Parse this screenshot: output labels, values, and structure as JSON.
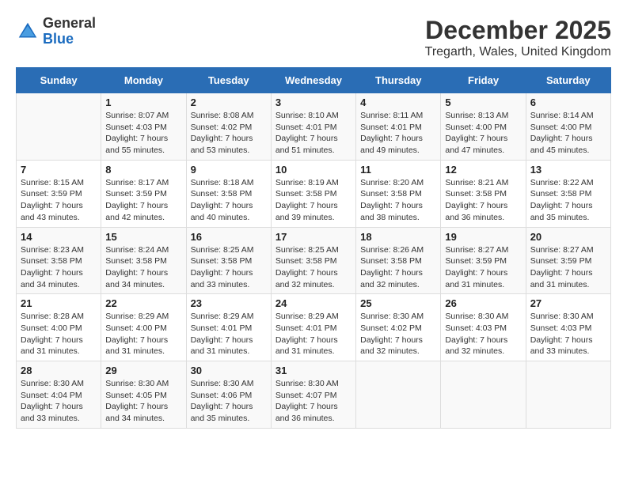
{
  "header": {
    "logo_general": "General",
    "logo_blue": "Blue",
    "title": "December 2025",
    "subtitle": "Tregarth, Wales, United Kingdom"
  },
  "days_of_week": [
    "Sunday",
    "Monday",
    "Tuesday",
    "Wednesday",
    "Thursday",
    "Friday",
    "Saturday"
  ],
  "weeks": [
    [
      {
        "day": "",
        "info": ""
      },
      {
        "day": "1",
        "info": "Sunrise: 8:07 AM\nSunset: 4:03 PM\nDaylight: 7 hours\nand 55 minutes."
      },
      {
        "day": "2",
        "info": "Sunrise: 8:08 AM\nSunset: 4:02 PM\nDaylight: 7 hours\nand 53 minutes."
      },
      {
        "day": "3",
        "info": "Sunrise: 8:10 AM\nSunset: 4:01 PM\nDaylight: 7 hours\nand 51 minutes."
      },
      {
        "day": "4",
        "info": "Sunrise: 8:11 AM\nSunset: 4:01 PM\nDaylight: 7 hours\nand 49 minutes."
      },
      {
        "day": "5",
        "info": "Sunrise: 8:13 AM\nSunset: 4:00 PM\nDaylight: 7 hours\nand 47 minutes."
      },
      {
        "day": "6",
        "info": "Sunrise: 8:14 AM\nSunset: 4:00 PM\nDaylight: 7 hours\nand 45 minutes."
      }
    ],
    [
      {
        "day": "7",
        "info": "Sunrise: 8:15 AM\nSunset: 3:59 PM\nDaylight: 7 hours\nand 43 minutes."
      },
      {
        "day": "8",
        "info": "Sunrise: 8:17 AM\nSunset: 3:59 PM\nDaylight: 7 hours\nand 42 minutes."
      },
      {
        "day": "9",
        "info": "Sunrise: 8:18 AM\nSunset: 3:58 PM\nDaylight: 7 hours\nand 40 minutes."
      },
      {
        "day": "10",
        "info": "Sunrise: 8:19 AM\nSunset: 3:58 PM\nDaylight: 7 hours\nand 39 minutes."
      },
      {
        "day": "11",
        "info": "Sunrise: 8:20 AM\nSunset: 3:58 PM\nDaylight: 7 hours\nand 38 minutes."
      },
      {
        "day": "12",
        "info": "Sunrise: 8:21 AM\nSunset: 3:58 PM\nDaylight: 7 hours\nand 36 minutes."
      },
      {
        "day": "13",
        "info": "Sunrise: 8:22 AM\nSunset: 3:58 PM\nDaylight: 7 hours\nand 35 minutes."
      }
    ],
    [
      {
        "day": "14",
        "info": "Sunrise: 8:23 AM\nSunset: 3:58 PM\nDaylight: 7 hours\nand 34 minutes."
      },
      {
        "day": "15",
        "info": "Sunrise: 8:24 AM\nSunset: 3:58 PM\nDaylight: 7 hours\nand 34 minutes."
      },
      {
        "day": "16",
        "info": "Sunrise: 8:25 AM\nSunset: 3:58 PM\nDaylight: 7 hours\nand 33 minutes."
      },
      {
        "day": "17",
        "info": "Sunrise: 8:25 AM\nSunset: 3:58 PM\nDaylight: 7 hours\nand 32 minutes."
      },
      {
        "day": "18",
        "info": "Sunrise: 8:26 AM\nSunset: 3:58 PM\nDaylight: 7 hours\nand 32 minutes."
      },
      {
        "day": "19",
        "info": "Sunrise: 8:27 AM\nSunset: 3:59 PM\nDaylight: 7 hours\nand 31 minutes."
      },
      {
        "day": "20",
        "info": "Sunrise: 8:27 AM\nSunset: 3:59 PM\nDaylight: 7 hours\nand 31 minutes."
      }
    ],
    [
      {
        "day": "21",
        "info": "Sunrise: 8:28 AM\nSunset: 4:00 PM\nDaylight: 7 hours\nand 31 minutes."
      },
      {
        "day": "22",
        "info": "Sunrise: 8:29 AM\nSunset: 4:00 PM\nDaylight: 7 hours\nand 31 minutes."
      },
      {
        "day": "23",
        "info": "Sunrise: 8:29 AM\nSunset: 4:01 PM\nDaylight: 7 hours\nand 31 minutes."
      },
      {
        "day": "24",
        "info": "Sunrise: 8:29 AM\nSunset: 4:01 PM\nDaylight: 7 hours\nand 31 minutes."
      },
      {
        "day": "25",
        "info": "Sunrise: 8:30 AM\nSunset: 4:02 PM\nDaylight: 7 hours\nand 32 minutes."
      },
      {
        "day": "26",
        "info": "Sunrise: 8:30 AM\nSunset: 4:03 PM\nDaylight: 7 hours\nand 32 minutes."
      },
      {
        "day": "27",
        "info": "Sunrise: 8:30 AM\nSunset: 4:03 PM\nDaylight: 7 hours\nand 33 minutes."
      }
    ],
    [
      {
        "day": "28",
        "info": "Sunrise: 8:30 AM\nSunset: 4:04 PM\nDaylight: 7 hours\nand 33 minutes."
      },
      {
        "day": "29",
        "info": "Sunrise: 8:30 AM\nSunset: 4:05 PM\nDaylight: 7 hours\nand 34 minutes."
      },
      {
        "day": "30",
        "info": "Sunrise: 8:30 AM\nSunset: 4:06 PM\nDaylight: 7 hours\nand 35 minutes."
      },
      {
        "day": "31",
        "info": "Sunrise: 8:30 AM\nSunset: 4:07 PM\nDaylight: 7 hours\nand 36 minutes."
      },
      {
        "day": "",
        "info": ""
      },
      {
        "day": "",
        "info": ""
      },
      {
        "day": "",
        "info": ""
      }
    ]
  ]
}
